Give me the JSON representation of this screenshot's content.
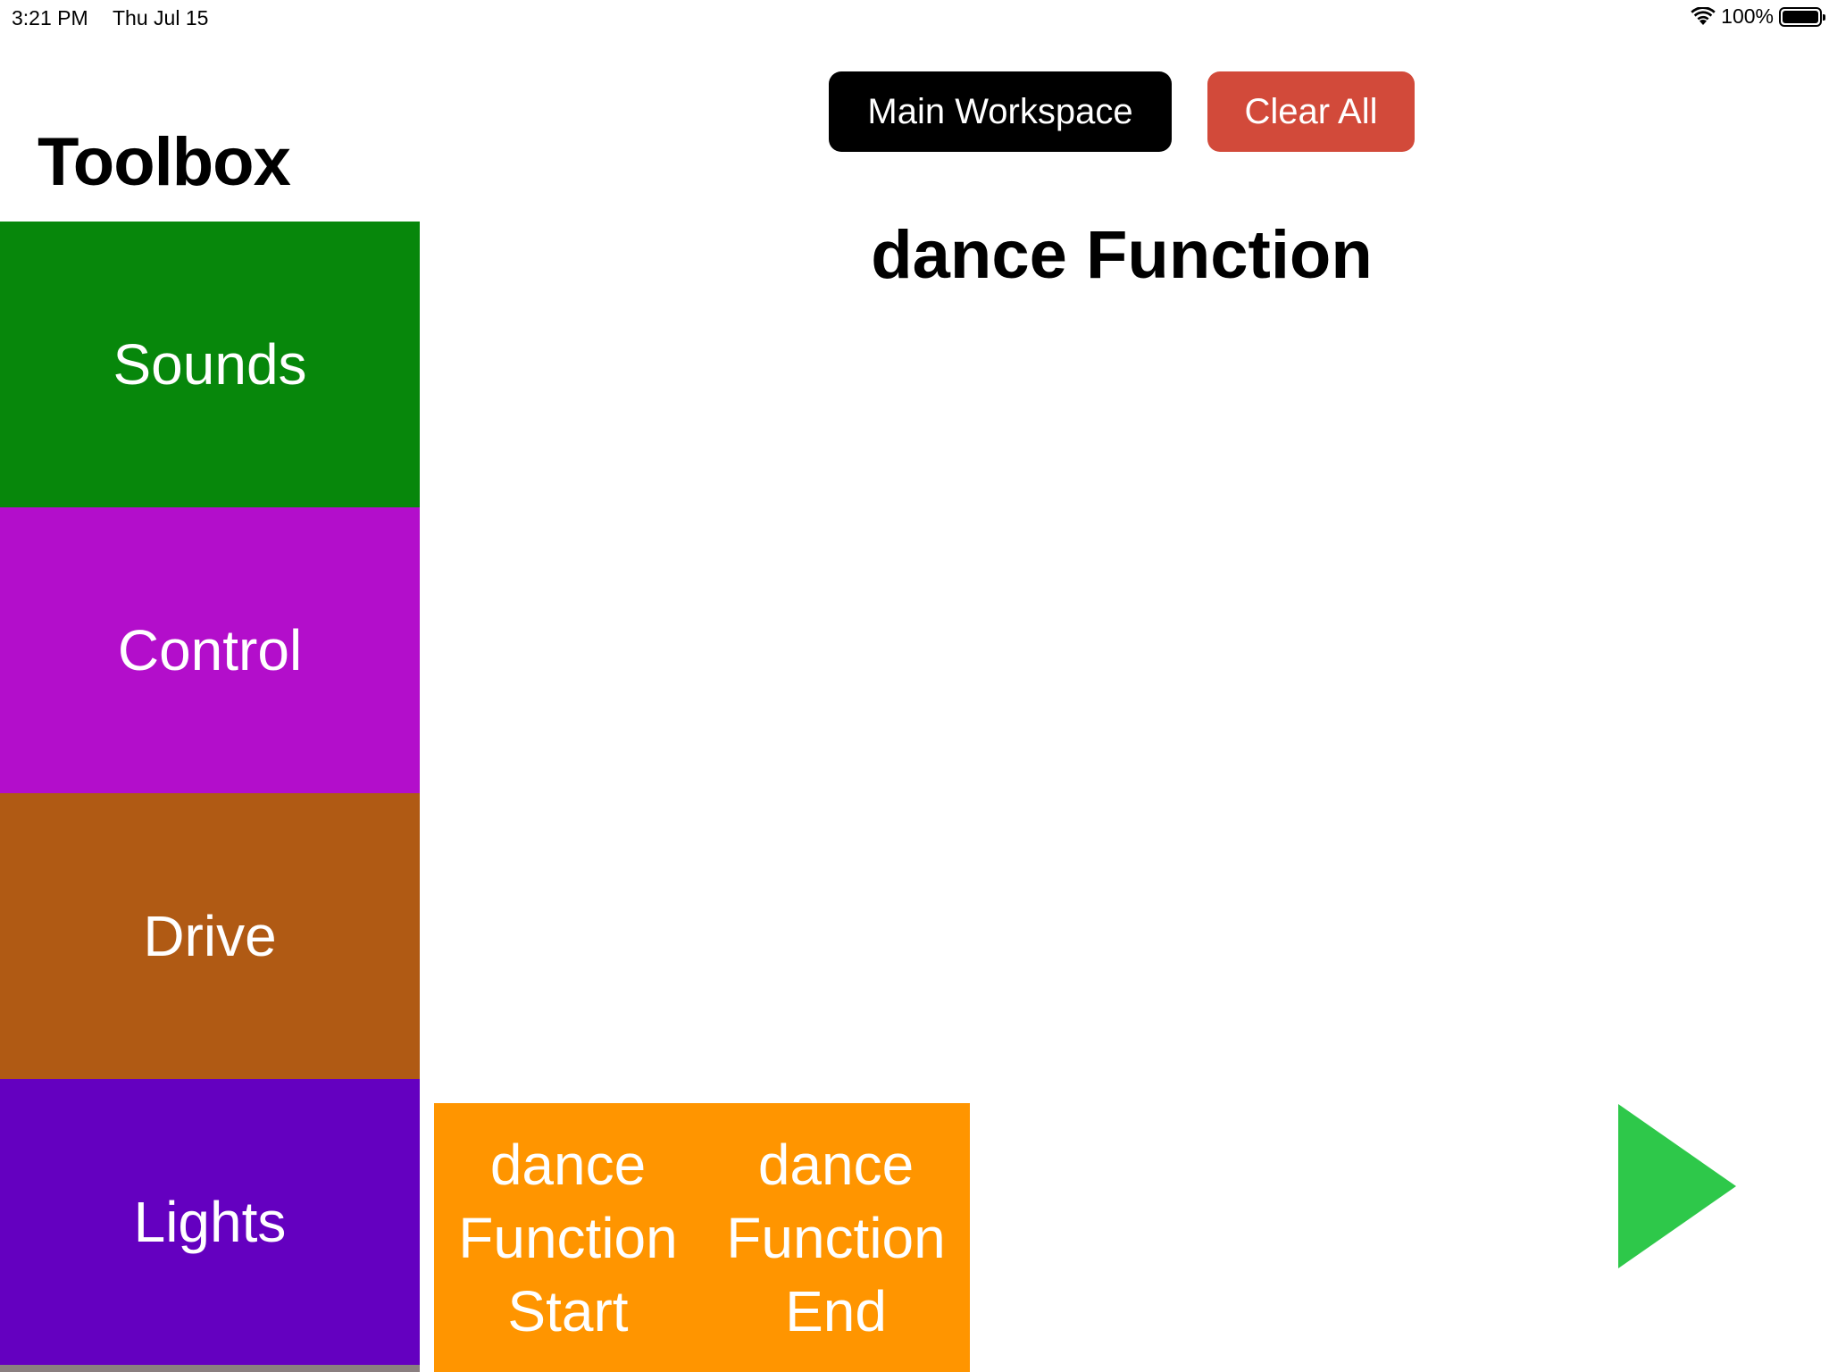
{
  "status_bar": {
    "time": "3:21 PM",
    "date": "Thu Jul 15",
    "battery_percent": "100%"
  },
  "toolbox": {
    "title": "Toolbox",
    "categories": [
      {
        "label": "Sounds",
        "color": "#07870b"
      },
      {
        "label": "Control",
        "color": "#b30ecb"
      },
      {
        "label": "Drive",
        "color": "#b05a14"
      },
      {
        "label": "Lights",
        "color": "#6400c0"
      }
    ]
  },
  "header": {
    "main_workspace_label": "Main Workspace",
    "clear_all_label": "Clear All"
  },
  "workspace": {
    "title": "dance Function",
    "blocks": [
      {
        "lines": [
          "dance",
          "Function",
          "Start"
        ],
        "color": "#ff9500"
      },
      {
        "lines": [
          "dance",
          "Function",
          "End"
        ],
        "color": "#ff9500"
      }
    ]
  },
  "icons": {
    "play": "play-icon",
    "wifi": "wifi-icon",
    "battery": "battery-icon"
  },
  "colors": {
    "main_button": "#000000",
    "clear_button": "#d24a3a",
    "play": "#2ec84a"
  }
}
